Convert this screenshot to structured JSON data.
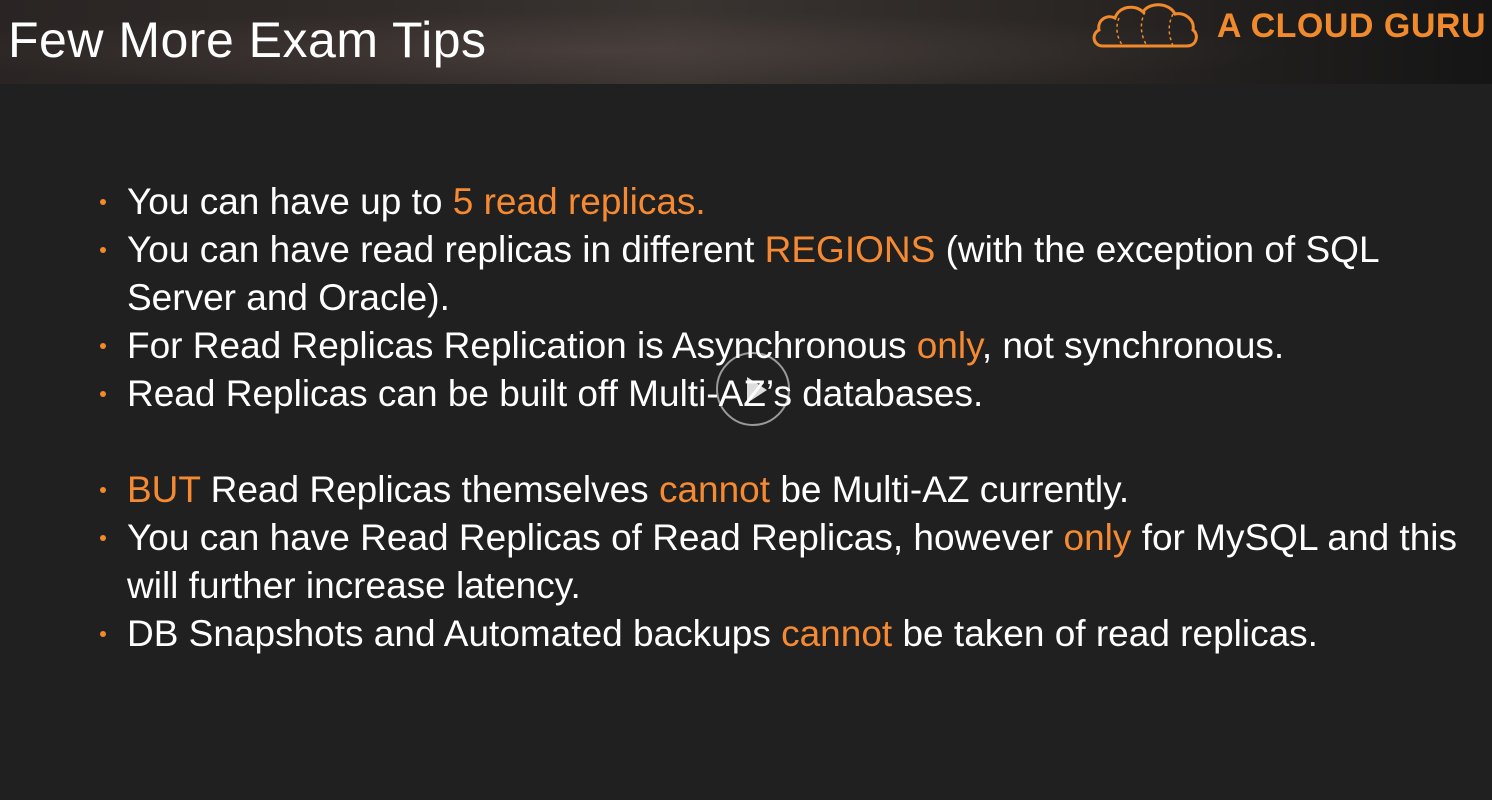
{
  "slide": {
    "title": "Few More Exam Tips",
    "brand_text": "A CLOUD GURU",
    "accent_color": "#f58a32",
    "background_color": "#202020"
  },
  "video_overlay": {
    "icon": "play-icon"
  },
  "bullets": [
    {
      "segments": [
        {
          "text": "You can have up to ",
          "highlight": false
        },
        {
          "text": "5 read replicas.",
          "highlight": true
        }
      ]
    },
    {
      "segments": [
        {
          "text": "You can have read replicas in different ",
          "highlight": false
        },
        {
          "text": "REGIONS",
          "highlight": true
        },
        {
          "text": " (with the exception of SQL Server and Oracle).",
          "highlight": false
        }
      ]
    },
    {
      "segments": [
        {
          "text": "For Read Replicas Replication is Asynchronous ",
          "highlight": false
        },
        {
          "text": "only",
          "highlight": true
        },
        {
          "text": ", not synchronous.",
          "highlight": false
        }
      ]
    },
    {
      "segments": [
        {
          "text": "Read Replicas can be built off Multi-AZ’s databases.",
          "highlight": false
        }
      ]
    },
    {
      "gap_before": true,
      "segments": [
        {
          "text": "BUT",
          "highlight": true
        },
        {
          "text": " Read Replicas themselves ",
          "highlight": false
        },
        {
          "text": "cannot",
          "highlight": true
        },
        {
          "text": " be Multi-AZ currently.",
          "highlight": false
        }
      ]
    },
    {
      "segments": [
        {
          "text": "You can have Read Replicas of Read Replicas, however ",
          "highlight": false
        },
        {
          "text": "only",
          "highlight": true
        },
        {
          "text": " for MySQL and this will further increase latency.",
          "highlight": false
        }
      ]
    },
    {
      "segments": [
        {
          "text": "DB Snapshots and Automated backups ",
          "highlight": false
        },
        {
          "text": "cannot",
          "highlight": true
        },
        {
          "text": " be taken of read replicas.",
          "highlight": false
        }
      ]
    }
  ]
}
